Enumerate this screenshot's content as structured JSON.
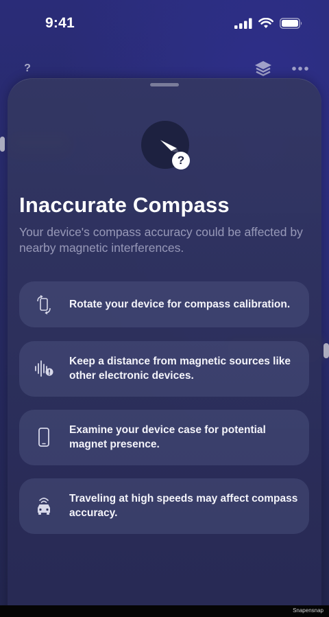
{
  "status_bar": {
    "time": "9:41"
  },
  "top_bar": {
    "help_glyph": "?",
    "layers_icon": "layers-icon",
    "more_icon": "ellipsis-icon"
  },
  "sheet": {
    "hero_icon": "compass-needle-icon",
    "hero_badge": "?",
    "title": "Inaccurate Compass",
    "subtitle": "Your device's compass accuracy could be affected by nearby magnetic interferences.",
    "tips": [
      {
        "icon": "rotate-device-icon",
        "text": "Rotate your device for compass calibration."
      },
      {
        "icon": "magnetic-waves-warning-icon",
        "text": "Keep a distance from magnetic sources like other electronic devices."
      },
      {
        "icon": "phone-case-icon",
        "text": "Examine your device case for potential magnet presence."
      },
      {
        "icon": "car-signal-icon",
        "text": "Traveling at high speeds may affect compass accuracy."
      }
    ]
  },
  "footer": {
    "watermark": "Snapensnap"
  },
  "colors": {
    "background": "#26295e",
    "sheet": "#2d305c",
    "card": "#4a4f80",
    "text": "#ffffff",
    "subtle_text": "#9a9cbf"
  }
}
